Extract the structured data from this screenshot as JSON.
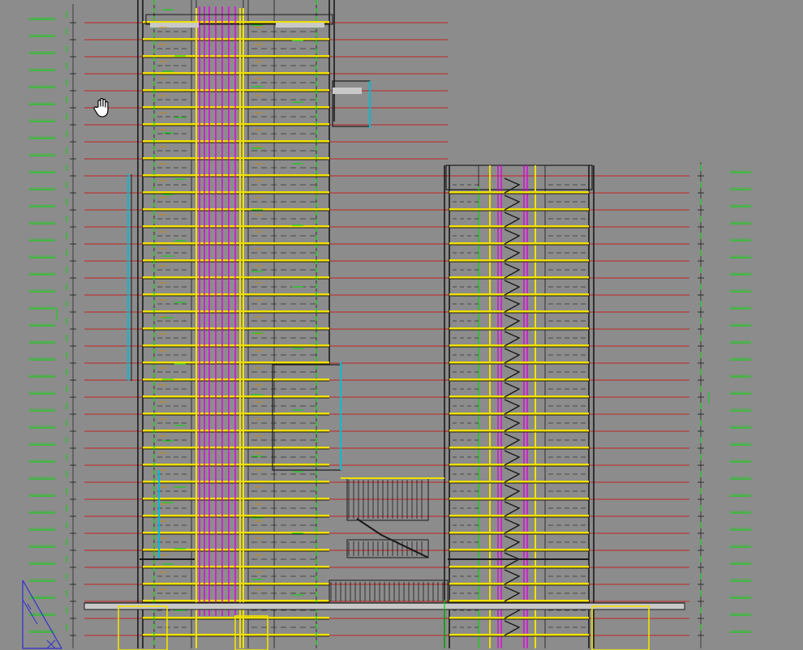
{
  "colors": {
    "background": "#8c8c8c",
    "structure": "#1a1a1a",
    "level_line": "#d40000",
    "slab": "#f0e000",
    "shaft": "#e000e0",
    "annotation": "#00dd00",
    "window": "#00bcd4",
    "fill": "#c8c8c8"
  },
  "cursor": {
    "icon": "pan-hand-icon"
  }
}
